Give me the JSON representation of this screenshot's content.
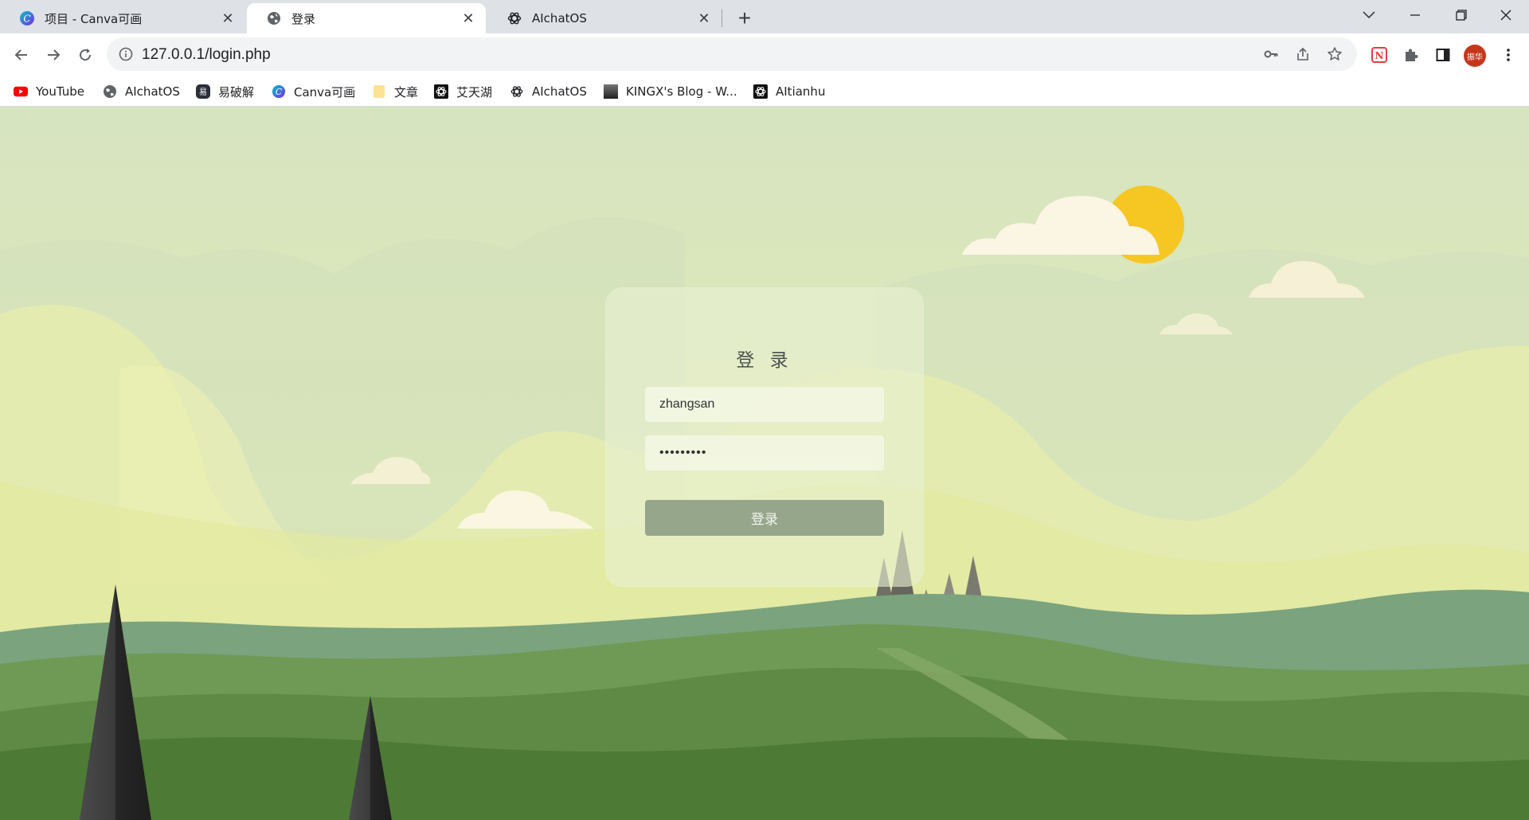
{
  "tabs": [
    {
      "title": "项目 - Canva可画",
      "favicon": "canva-icon",
      "active": false
    },
    {
      "title": "登录",
      "favicon": "globe-icon",
      "active": true
    },
    {
      "title": "AIchatOS",
      "favicon": "openai-icon",
      "active": false
    }
  ],
  "toolbar": {
    "url": "127.0.0.1/login.php",
    "profile_label": "振华"
  },
  "bookmarks": [
    {
      "label": "YouTube",
      "icon": "youtube-icon"
    },
    {
      "label": "AIchatOS",
      "icon": "globe-icon"
    },
    {
      "label": "易破解",
      "icon": "yipojie-icon"
    },
    {
      "label": "Canva可画",
      "icon": "canva-icon"
    },
    {
      "label": "文章",
      "icon": "folder-icon"
    },
    {
      "label": "艾天湖",
      "icon": "openai-icon"
    },
    {
      "label": "AIchatOS",
      "icon": "openai-icon"
    },
    {
      "label": "KINGX's Blog - W...",
      "icon": "blog-icon"
    },
    {
      "label": "AItianhu",
      "icon": "openai-icon"
    }
  ],
  "login": {
    "title": "登 录",
    "username_value": "zhangsan",
    "password_value": "•••••••••",
    "button_label": "登录"
  },
  "colors": {
    "sky_top": "#d9e6c4",
    "hill_light": "#6f9a56",
    "hill_dark": "#4d7a34",
    "sun": "#f6c623",
    "button": "#96a68b"
  }
}
